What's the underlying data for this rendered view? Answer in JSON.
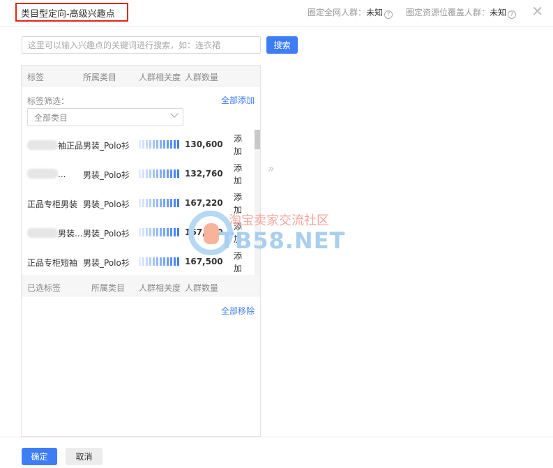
{
  "header": {
    "title": "类目型定向-高级兴趣点",
    "crowd_all_label": "圈定全网人群：",
    "crowd_all_value": "未知",
    "crowd_res_label": "圈定资源位覆盖人群：",
    "crowd_res_value": "未知",
    "help_glyph": "?",
    "close_glyph": "✕"
  },
  "search": {
    "placeholder": "这里可以输入兴趣点的关键词进行搜索，如：连衣裙",
    "button_label": "搜索"
  },
  "candidate_table": {
    "columns": [
      "标签",
      "所属类目",
      "人群相关度",
      "人群数量"
    ],
    "filter_label": "标签筛选：",
    "add_all_label": "全部添加",
    "category_select_value": "全部类目",
    "row_action_label": "添加",
    "rows": [
      {
        "tag_visible": "袖正品",
        "category": "男装_Polo衫",
        "relevance": 1.0,
        "count": "130,600"
      },
      {
        "tag_visible": "...",
        "category": "男装_Polo衫",
        "relevance": 1.0,
        "count": "132,760"
      },
      {
        "tag_visible": "正品专柜男装",
        "category": "男装_Polo衫",
        "relevance": 1.0,
        "count": "167,220"
      },
      {
        "tag_visible": "男装...",
        "category": "男装_Polo衫",
        "relevance": 1.0,
        "count": "167,260"
      },
      {
        "tag_visible": "正品专柜短袖",
        "category": "男装_Polo衫",
        "relevance": 1.0,
        "count": "167,500"
      }
    ]
  },
  "transfer_arrows": "»",
  "selected_table": {
    "columns": [
      "已选标签",
      "所属类目",
      "人群相关度",
      "人群数量"
    ],
    "remove_all_label": "全部移除"
  },
  "watermark": {
    "text_cn": "淘宝卖家交流社区",
    "text_en": "TB58.NET"
  },
  "footer": {
    "confirm_label": "确定",
    "cancel_label": "取消"
  },
  "colors": {
    "accent": "#3d7ef6",
    "title_border": "#e1251b"
  }
}
